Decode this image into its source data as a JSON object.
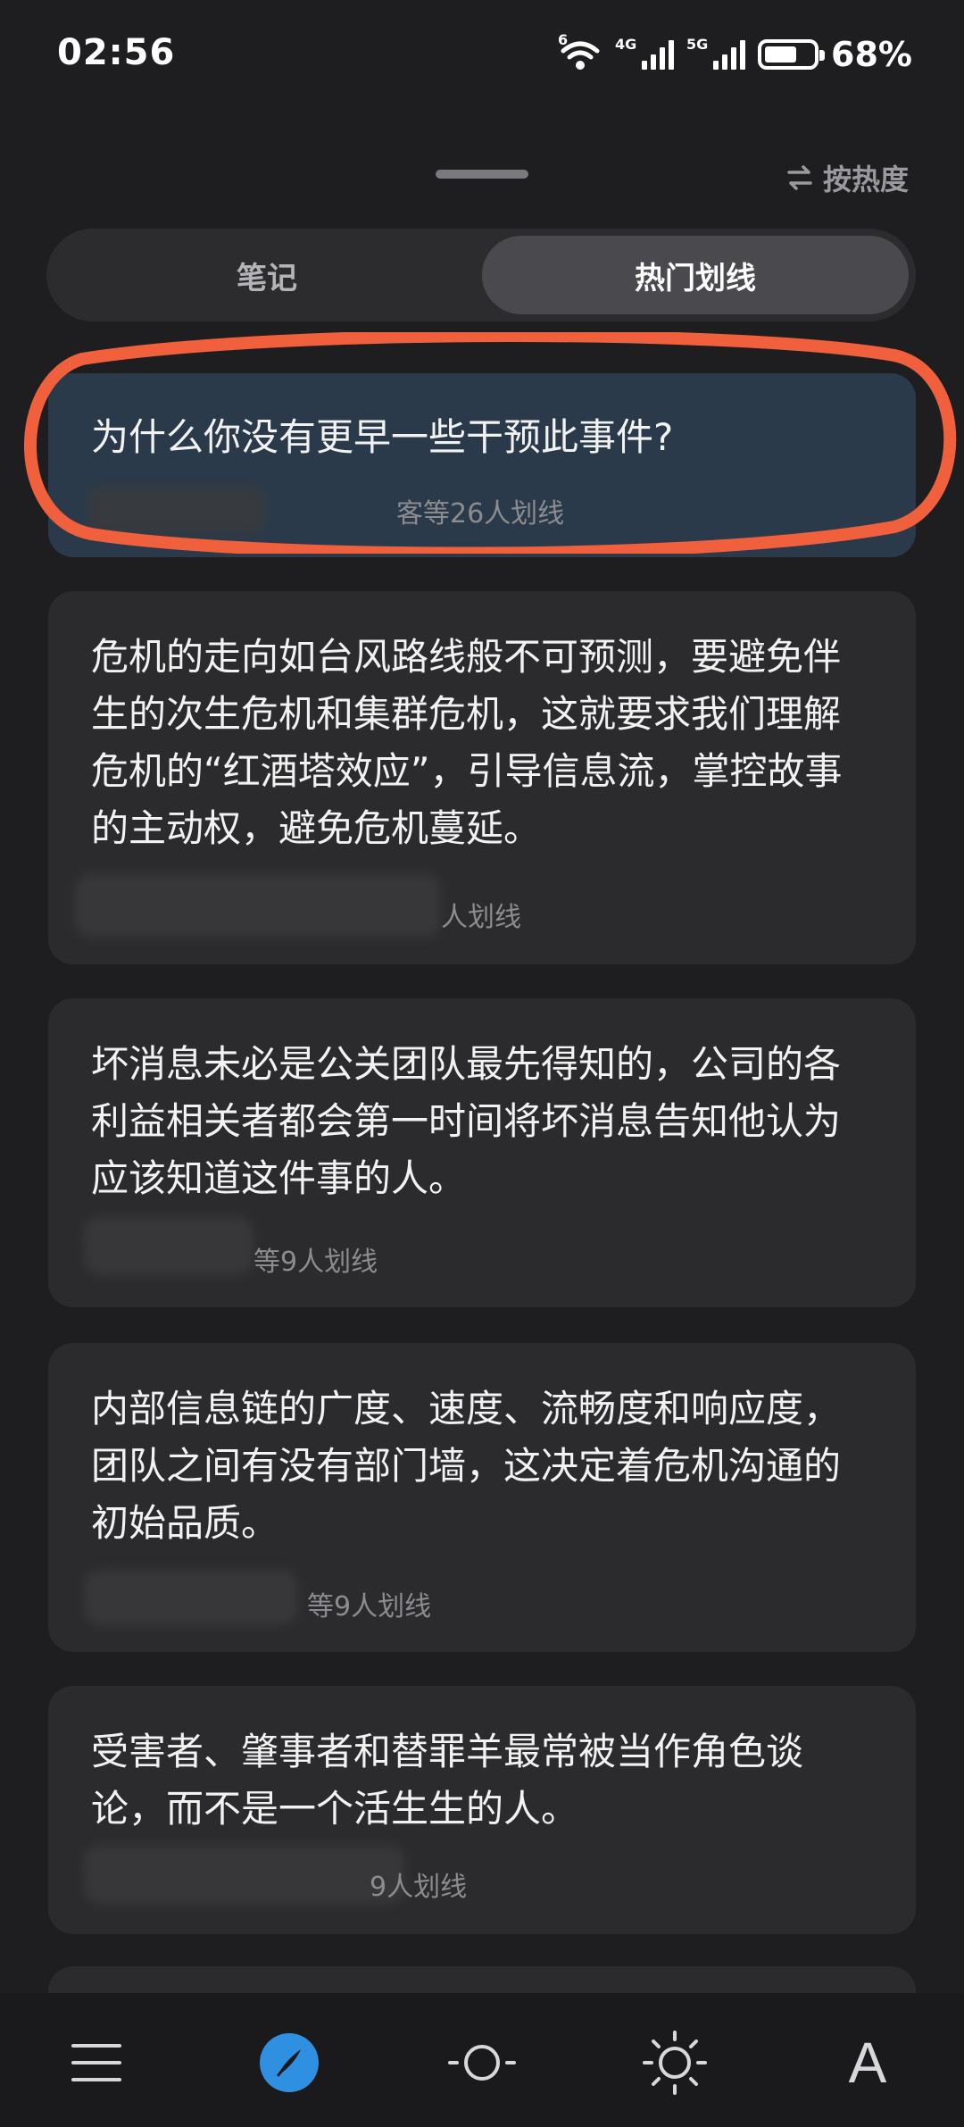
{
  "status_bar": {
    "time": "02:56",
    "wifi_label": "6",
    "sim1_label": "4G",
    "sim2_label": "5G",
    "battery_text": "68%",
    "battery_level": 0.68
  },
  "header": {
    "sort_label": "按热度"
  },
  "tabs": [
    {
      "label": "笔记",
      "active": false
    },
    {
      "label": "热门划线",
      "active": true
    }
  ],
  "cards": [
    {
      "text": "为什么你没有更早一些干预此事件?",
      "meta": "客等26人划线",
      "highlighted": true
    },
    {
      "text": "危机的走向如台风路线般不可预测，要避免伴生的次生危机和集群危机，这就要求我们理解危机的“红酒塔效应”，引导信息流，掌控故事的主动权，避免危机蔓延。",
      "meta": "人划线",
      "highlighted": false
    },
    {
      "text": "坏消息未必是公关团队最先得知的，公司的各利益相关者都会第一时间将坏消息告知他认为应该知道这件事的人。",
      "meta": "等9人划线",
      "highlighted": false
    },
    {
      "text": "内部信息链的广度、速度、流畅度和响应度，团队之间有没有部门墙，这决定着危机沟通的初始品质。",
      "meta": "等9人划线",
      "highlighted": false
    },
    {
      "text": "受害者、肇事者和替罪羊最常被当作角色谈论，而不是一个活生生的人。",
      "meta": "9人划线",
      "highlighted": false
    }
  ],
  "bottom_nav": {
    "font_label": "A",
    "items": [
      "menu-icon",
      "compass-icon",
      "brightness-low-icon",
      "brightness-high-icon",
      "font-icon"
    ],
    "active": "compass-icon"
  },
  "colors": {
    "background": "#1e1e20",
    "card": "#2b2b2e",
    "highlight_card": "#2a3a4a",
    "annotation": "#f0603c",
    "accent": "#2f8fe0"
  }
}
